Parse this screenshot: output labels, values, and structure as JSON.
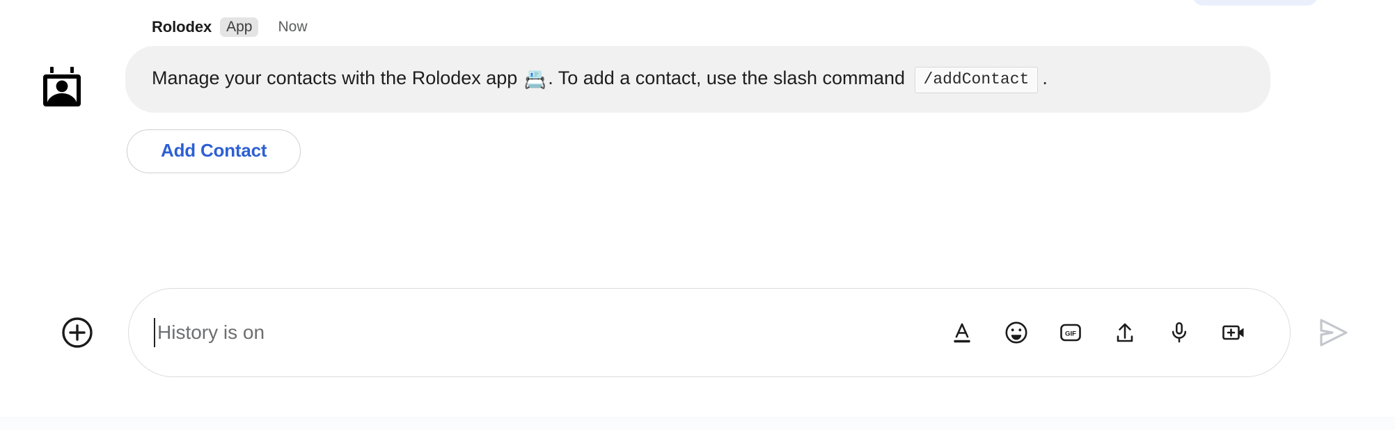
{
  "window": {
    "background_color": "#ffffff",
    "accent_color": "#2d5fd4"
  },
  "top_pill": {
    "color": "#eaf0fb"
  },
  "message": {
    "avatar_icon": "rolodex-contact-card-icon",
    "sender": "Rolodex",
    "badge": "App",
    "timestamp": "Now",
    "bubble_color": "#f1f1f1",
    "text_part1": "Manage your contacts with the Rolodex app ",
    "emoji": "📇",
    "text_part2": ". To add a contact, use the slash command ",
    "code": "/addContact",
    "text_part3": "."
  },
  "actions": {
    "add_contact_label": "Add Contact"
  },
  "composer": {
    "add_attachment_icon": "plus-circle-icon",
    "input_value": "",
    "placeholder": "History is on",
    "tools": [
      {
        "name": "format-text-icon",
        "label": "Format text"
      },
      {
        "name": "emoji-icon",
        "label": "Insert emoji"
      },
      {
        "name": "gif-icon",
        "label": "Insert GIF"
      },
      {
        "name": "upload-icon",
        "label": "Upload file"
      },
      {
        "name": "microphone-icon",
        "label": "Record audio"
      },
      {
        "name": "video-add-icon",
        "label": "Start video"
      }
    ],
    "send_icon": "send-paper-plane-icon",
    "send_enabled": false
  }
}
